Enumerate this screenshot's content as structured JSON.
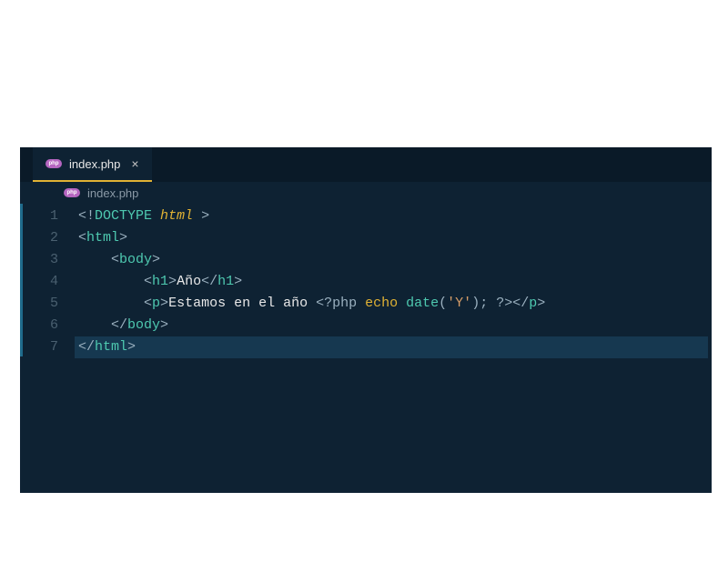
{
  "tab": {
    "filename": "index.php",
    "icon_label": "php"
  },
  "breadcrumb": {
    "filename": "index.php",
    "icon_label": "php"
  },
  "line_numbers": [
    "1",
    "2",
    "3",
    "4",
    "5",
    "6",
    "7"
  ],
  "code": {
    "l1": {
      "open": "<!",
      "doctype": "DOCTYPE",
      "sp": " ",
      "html": "html",
      "close": " >"
    },
    "l2": {
      "open": "<",
      "tag": "html",
      "close": ">"
    },
    "l3": {
      "indent": "    ",
      "open": "<",
      "tag": "body",
      "close": ">"
    },
    "l4": {
      "indent": "        ",
      "open": "<",
      "t1": "h1",
      "mid": ">",
      "text": "Año",
      "open2": "</",
      "t1b": "h1",
      "end": ">"
    },
    "l5": {
      "indent": "        ",
      "open": "<",
      "t1": "p",
      "mid": ">",
      "text": "Estamos en el año ",
      "phpopen": "<?php ",
      "echo": "echo",
      "sp": " ",
      "fn": "date",
      "paren_open": "(",
      "str": "'Y'",
      "paren_close": ")",
      "semi": "; ",
      "phpclose": "?>",
      "open2": "</",
      "t1b": "p",
      "end": ">"
    },
    "l6": {
      "indent": "    ",
      "open": "</",
      "tag": "body",
      "close": ">"
    },
    "l7": {
      "open": "</",
      "tag": "html",
      "close": ">"
    }
  }
}
